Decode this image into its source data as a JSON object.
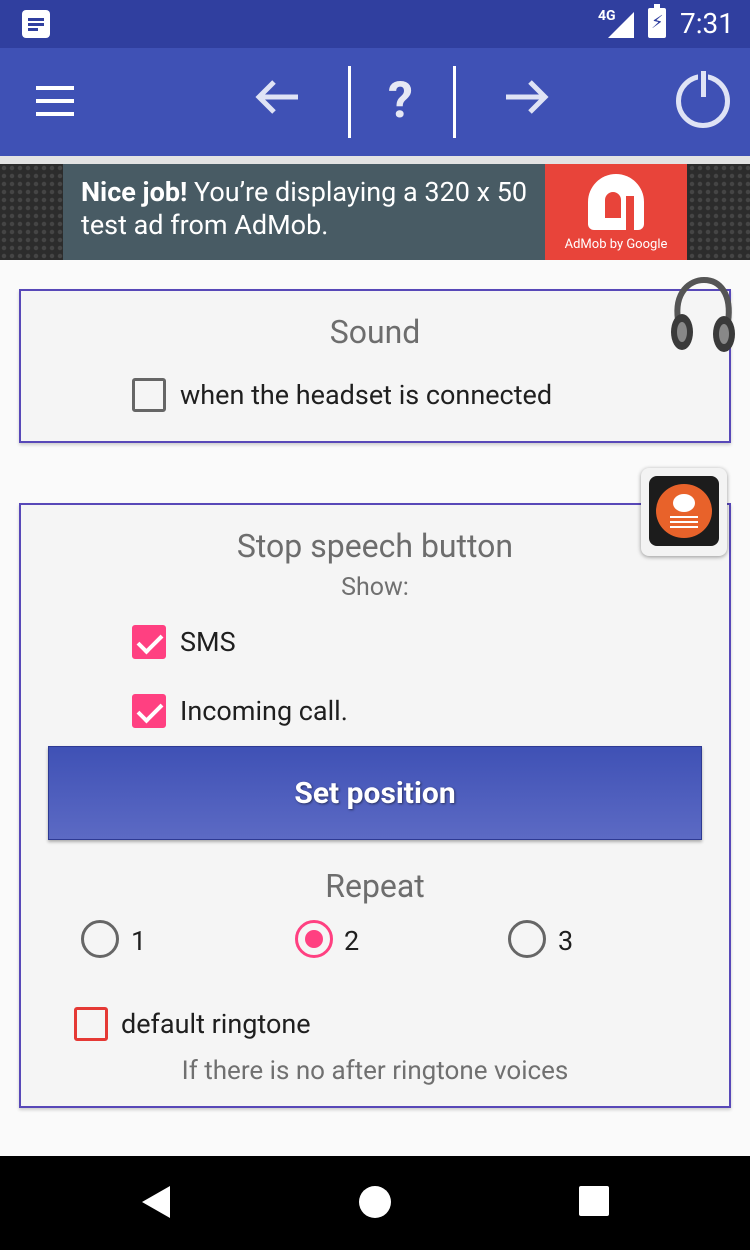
{
  "status_bar": {
    "network": "4G",
    "time": "7:31"
  },
  "toolbar": {
    "menu_icon": "hamburger-icon",
    "back_icon": "arrow-left-icon",
    "help_label": "?",
    "forward_icon": "arrow-right-icon",
    "power_icon": "power-icon",
    "color": "#3f51b5"
  },
  "ad": {
    "bold_text": "Nice job!",
    "text": " You’re displaying a 320 x 50 test ad from AdMob.",
    "brand": "AdMob by Google",
    "brand_color": "#e8443a"
  },
  "sound_card": {
    "title": "Sound",
    "headset_checkbox": {
      "label": "when the headset is connected",
      "checked": false
    }
  },
  "stop_speech_card": {
    "title": "Stop speech button",
    "subtitle": "Show:",
    "sms": {
      "label": "SMS",
      "checked": true
    },
    "incoming_call": {
      "label": "Incoming call.",
      "checked": true
    },
    "set_position_label": "Set position",
    "repeat": {
      "title": "Repeat",
      "options": [
        "1",
        "2",
        "3"
      ],
      "selected": "2"
    },
    "default_ringtone": {
      "label": "default ringtone",
      "checked": false
    },
    "hint": "If there is no after ringtone voices"
  },
  "accent_color": "#ff4081"
}
